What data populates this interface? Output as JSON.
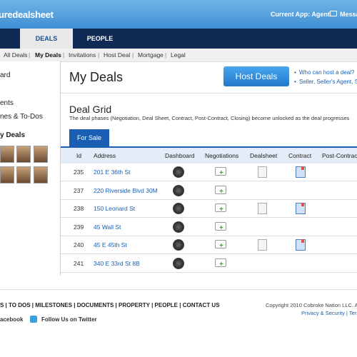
{
  "header": {
    "logo_text": "uredealsheet",
    "current_app": "Current App: Agent",
    "messages": "Messa"
  },
  "nav": {
    "tabs": [
      {
        "label": "DEALS"
      },
      {
        "label": "PEOPLE"
      }
    ]
  },
  "subnav": {
    "items": [
      "All Deals",
      "My Deals",
      "Invitations",
      "Host Deal",
      "Mortgage",
      "Legal"
    ],
    "separator": "|"
  },
  "sidebar": {
    "items": [
      "ard",
      "ents",
      "nes & To-Dos",
      "y Deals"
    ]
  },
  "main": {
    "title": "My Deals",
    "host_button": "Host Deals",
    "links": [
      "Who can host a deal?",
      "Seller, Seller's Agent, S"
    ]
  },
  "grid": {
    "title": "Deal Grid",
    "description": "The deal phases (Negotiation, Deal Sheet, Contract, Post-Contract, Closing) become unlocked as the deal progresses",
    "tab": "For Sale",
    "columns": [
      "Id",
      "Address",
      "Dashboard",
      "Negotiations",
      "Dealsheet",
      "Contract",
      "Post-Contract"
    ],
    "rows": [
      {
        "id": "235",
        "address": "201 E 36th St",
        "dealsheet": true,
        "contract": true
      },
      {
        "id": "237",
        "address": "220 Riverside Blvd 30M",
        "dealsheet": false,
        "contract": false
      },
      {
        "id": "238",
        "address": "150 Leonard St",
        "dealsheet": true,
        "contract": true
      },
      {
        "id": "239",
        "address": "45 Wall St",
        "dealsheet": false,
        "contract": false
      },
      {
        "id": "240",
        "address": "45 E 45th St",
        "dealsheet": true,
        "contract": true
      },
      {
        "id": "241",
        "address": "340 E 33rd St 8B",
        "dealsheet": false,
        "contract": false
      }
    ]
  },
  "footer": {
    "links": "S | TO DOS | MILESTONES | DOCUMENTS | PROPERTY | PEOPLE | CONTACT US",
    "copyright": "Copyright 2010 Cobroke Nation LLC. All",
    "privacy": "Privacy & Security | Term",
    "facebook": "acebook",
    "twitter": "Follow Us on Twitter"
  },
  "colors": {
    "brand_blue": "#1a5fb4",
    "nav_dark": "#0f2a55",
    "topbar": "#3f8fd3"
  }
}
